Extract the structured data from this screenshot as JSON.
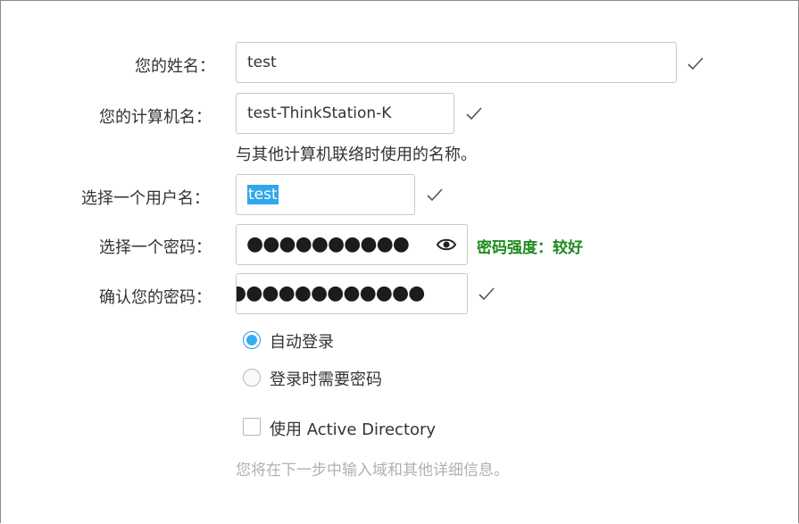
{
  "form": {
    "fullname": {
      "label": "您的姓名：",
      "value": "test"
    },
    "computer_name": {
      "label": "您的计算机名：",
      "value": "test-ThinkStation-K",
      "hint": "与其他计算机联络时使用的名称。"
    },
    "username": {
      "label": "选择一个用户名：",
      "value": "test"
    },
    "password": {
      "label": "选择一个密码：",
      "masked": "●●●●●●●●●●",
      "strength": "密码强度：较好"
    },
    "confirm_password": {
      "label": "确认您的密码：",
      "masked": "●●●●●●●●●●●●"
    },
    "login_options": [
      {
        "label": "自动登录",
        "selected": true
      },
      {
        "label": "登录时需要密码",
        "selected": false
      }
    ],
    "active_directory": {
      "label": "使用 Active Directory",
      "checked": false,
      "note": "您将在下一步中输入域和其他详细信息。"
    }
  },
  "colors": {
    "accent": "#35aef0",
    "strength_good": "#1e8a1e",
    "muted": "#b0b0b0"
  },
  "icons": {
    "valid": "checkmark-icon",
    "reveal": "eye-icon"
  }
}
